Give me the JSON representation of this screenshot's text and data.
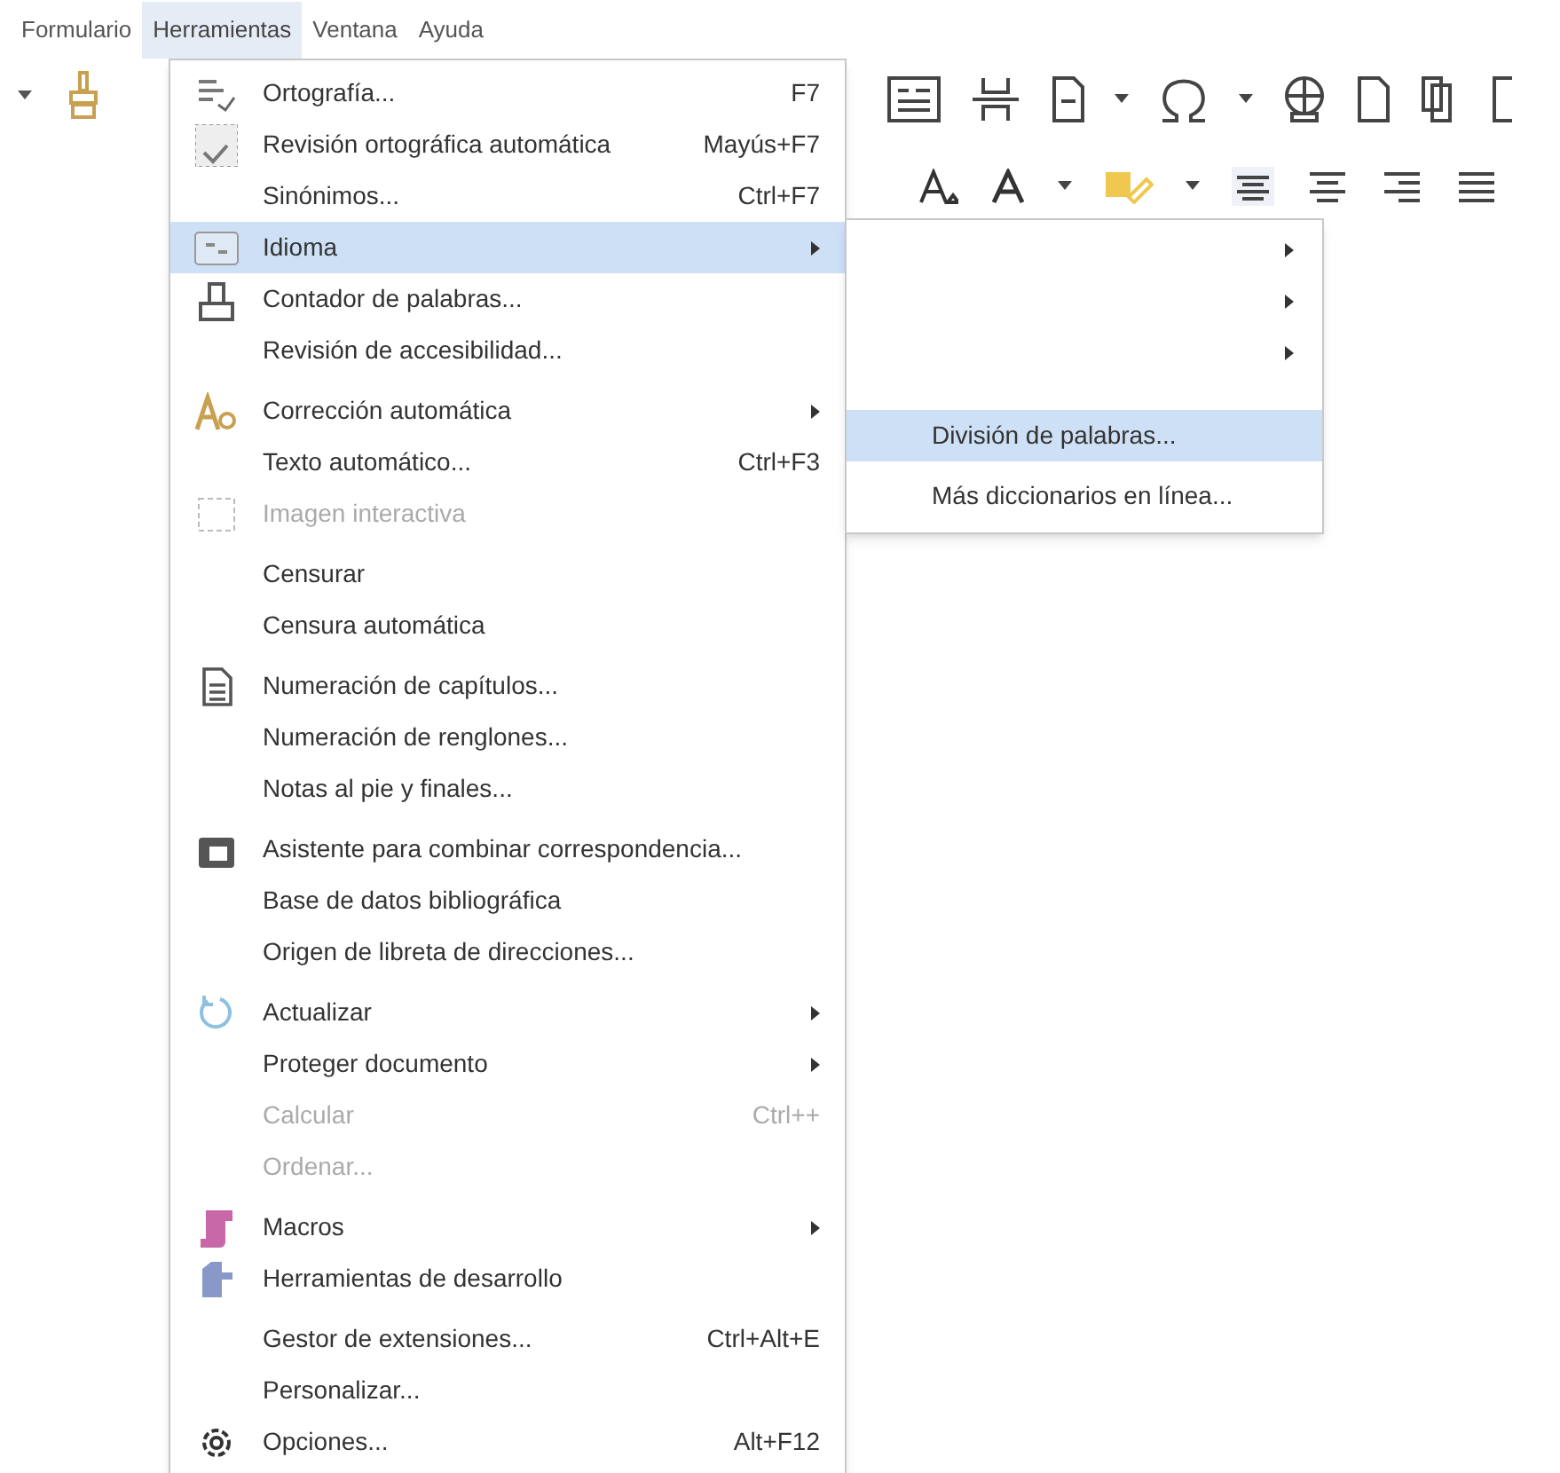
{
  "menubar": [
    {
      "label": "Formulario",
      "selected": false
    },
    {
      "label": "Herramientas",
      "selected": true
    },
    {
      "label": "Ventana",
      "selected": false
    },
    {
      "label": "Ayuda",
      "selected": false
    }
  ],
  "menu": {
    "groups": [
      [
        {
          "label": "Ortografía...",
          "shortcut": "F7",
          "disabled": false,
          "submenu": false,
          "selected": false
        },
        {
          "label": "Revisión ortográfica automática",
          "shortcut": "Mayús+F7",
          "disabled": false,
          "submenu": false,
          "selected": false
        },
        {
          "label": "Sinónimos...",
          "shortcut": "Ctrl+F7",
          "disabled": false,
          "submenu": false,
          "selected": false
        },
        {
          "label": "Idioma",
          "disabled": false,
          "submenu": true,
          "selected": true
        },
        {
          "label": "Contador de palabras...",
          "disabled": false,
          "submenu": false,
          "selected": false
        },
        {
          "label": "Revisión de accesibilidad...",
          "disabled": false,
          "submenu": false,
          "selected": false
        }
      ],
      [
        {
          "label": "Corrección automática",
          "disabled": false,
          "submenu": true,
          "selected": false
        },
        {
          "label": "Texto automático...",
          "shortcut": "Ctrl+F3",
          "disabled": false,
          "submenu": false,
          "selected": false
        },
        {
          "label": "Imagen interactiva",
          "disabled": true,
          "submenu": false,
          "selected": false
        }
      ],
      [
        {
          "label": "Censurar",
          "disabled": false,
          "submenu": false,
          "selected": false
        },
        {
          "label": "Censura automática",
          "disabled": false,
          "submenu": false,
          "selected": false
        }
      ],
      [
        {
          "label": "Numeración de capítulos...",
          "disabled": false,
          "submenu": false,
          "selected": false
        },
        {
          "label": "Numeración de renglones...",
          "disabled": false,
          "submenu": false,
          "selected": false
        },
        {
          "label": "Notas al pie y finales...",
          "disabled": false,
          "submenu": false,
          "selected": false
        }
      ],
      [
        {
          "label": "Asistente para combinar correspondencia...",
          "disabled": false,
          "submenu": false,
          "selected": false
        },
        {
          "label": "Base de datos bibliográfica",
          "disabled": false,
          "submenu": false,
          "selected": false
        },
        {
          "label": "Origen de libreta de direcciones...",
          "disabled": false,
          "submenu": false,
          "selected": false
        }
      ],
      [
        {
          "label": "Actualizar",
          "disabled": false,
          "submenu": true,
          "selected": false
        },
        {
          "label": "Proteger documento",
          "disabled": false,
          "submenu": true,
          "selected": false
        },
        {
          "label": "Calcular",
          "shortcut": "Ctrl++",
          "disabled": true,
          "submenu": false,
          "selected": false
        },
        {
          "label": "Ordenar...",
          "disabled": true,
          "submenu": false,
          "selected": false
        }
      ],
      [
        {
          "label": "Macros",
          "disabled": false,
          "submenu": true,
          "selected": false
        },
        {
          "label": "Herramientas de desarrollo",
          "disabled": false,
          "submenu": false,
          "selected": false
        }
      ],
      [
        {
          "label": "Gestor de extensiones...",
          "shortcut": "Ctrl+Alt+E",
          "disabled": false,
          "submenu": false,
          "selected": false
        },
        {
          "label": "Personalizar...",
          "disabled": false,
          "submenu": false,
          "selected": false
        },
        {
          "label": "Opciones...",
          "shortcut": "Alt+F12",
          "disabled": false,
          "submenu": false,
          "selected": false
        }
      ]
    ]
  },
  "submenu": {
    "items": [
      {
        "submenu": true,
        "selected": false
      },
      {
        "submenu": true,
        "selected": false
      },
      {
        "submenu": true,
        "selected": false
      },
      {
        "label": "División de palabras...",
        "submenu": false,
        "selected": true
      },
      {
        "label": "Más diccionarios en línea...",
        "submenu": false,
        "selected": false
      }
    ]
  }
}
